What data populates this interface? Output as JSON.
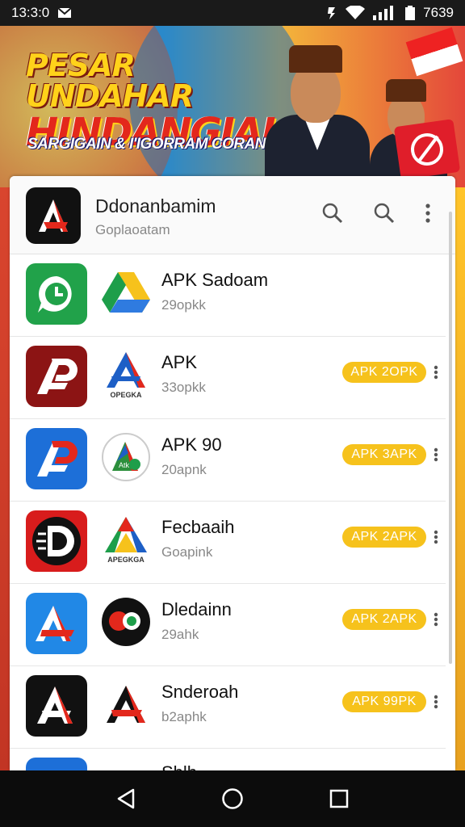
{
  "status_bar": {
    "time": "13:3:0",
    "battery_text": "7639",
    "icons": [
      "mail-icon",
      "data-icon",
      "wifi-icon",
      "signal-icon",
      "battery-icon"
    ]
  },
  "banner": {
    "title_line1": "PESAR UNDAHAR",
    "title_line2": "HINDANGIAI",
    "subtitle": "SARGIGAIN & I'IGORRAM CORANI",
    "colors": {
      "title_yellow": "#ffd21a",
      "title_red": "#e3281c"
    }
  },
  "app_header": {
    "name": "Ddonanbamim",
    "subtitle": "Goplaoatam",
    "actions": [
      "search-icon",
      "search-icon",
      "more-vert-icon"
    ]
  },
  "list": [
    {
      "title": "APK Sadoam",
      "size": "29opkk",
      "badge": "",
      "icon": "chat-clock-icon",
      "icon2": "drive-icon",
      "icon2_caption": ""
    },
    {
      "title": "APK",
      "size": "33opkk",
      "badge": "APK 2OPK",
      "icon": "ap-logo-icon",
      "icon2": "a-triangle-icon",
      "icon2_caption": "OPEGKA"
    },
    {
      "title": "APK 90",
      "size": "20apnk",
      "badge": "APK 3APK",
      "icon": "ap-logo-blue-icon",
      "icon2": "atk-round-icon",
      "icon2_caption": ""
    },
    {
      "title": "Fecbaaih",
      "size": "Goapink",
      "badge": "APK 2APK",
      "icon": "d-round-icon",
      "icon2": "drive-triangle-icon",
      "icon2_caption": "APEGKGA"
    },
    {
      "title": "Dledainn",
      "size": "29ahk",
      "badge": "APK 2APK",
      "icon": "a-blue-icon",
      "icon2": "ao-circle-icon",
      "icon2_caption": ""
    },
    {
      "title": "Snderoah",
      "size": "b2aphk",
      "badge": "APK 99PK",
      "icon": "a-black-icon",
      "icon2": "a-red-icon",
      "icon2_caption": ""
    },
    {
      "title": "Shlh",
      "size": "",
      "badge": "",
      "icon": "partial-icon",
      "icon2": "partial-icon",
      "icon2_caption": ""
    }
  ],
  "nav_bar": [
    "back-icon",
    "home-icon",
    "recents-icon"
  ],
  "colors": {
    "badge": "#f6c21c",
    "nav": "#0c0c0c"
  }
}
